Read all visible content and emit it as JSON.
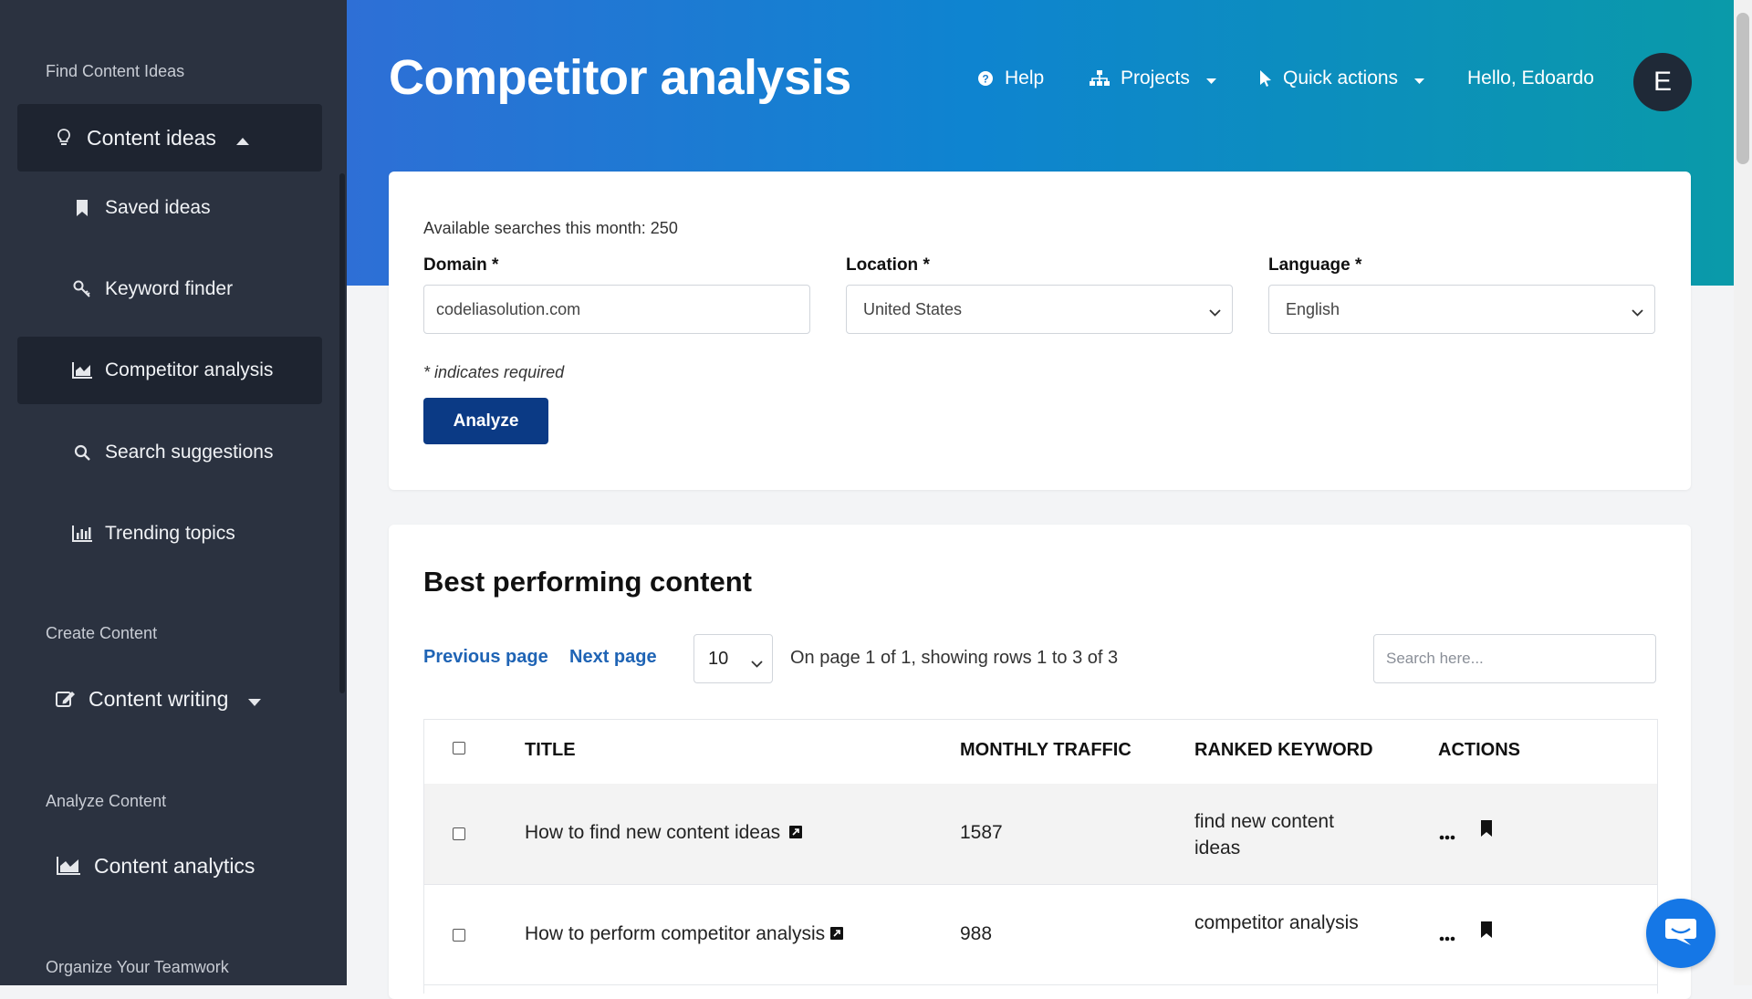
{
  "sidebar": {
    "sections": [
      "Find Content Ideas",
      "Create Content",
      "Analyze Content",
      "Organize Your Teamwork"
    ],
    "content_ideas": "Content ideas",
    "items": [
      {
        "label": "Saved ideas",
        "icon": "bookmark-icon"
      },
      {
        "label": "Keyword finder",
        "icon": "key-icon"
      },
      {
        "label": "Competitor analysis",
        "icon": "area-chart-icon"
      },
      {
        "label": "Search suggestions",
        "icon": "search-icon"
      },
      {
        "label": "Trending topics",
        "icon": "bar-chart-icon"
      }
    ],
    "content_writing": "Content writing",
    "content_analytics": "Content analytics"
  },
  "header": {
    "title": "Competitor analysis",
    "help": "Help",
    "projects": "Projects",
    "quick_actions": "Quick actions",
    "greeting": "Hello, Edoardo",
    "avatar_letter": "E"
  },
  "form": {
    "available": "Available searches this month: 250",
    "domain_label": "Domain *",
    "domain_value": "codeliasolution.com",
    "location_label": "Location *",
    "location_value": "United States",
    "language_label": "Language *",
    "language_value": "English",
    "required_note": "* indicates required",
    "analyze": "Analyze"
  },
  "results": {
    "title": "Best performing content",
    "prev": "Previous page",
    "next": "Next page",
    "page_size": "10",
    "page_info": "On page 1 of 1, showing rows 1 to 3 of 3",
    "search_placeholder": "Search here...",
    "columns": [
      "TITLE",
      "MONTHLY TRAFFIC",
      "RANKED KEYWORD",
      "ACTIONS"
    ],
    "rows": [
      {
        "title": "How to find new content ideas",
        "traffic": "1587",
        "keyword": "find new content ideas"
      },
      {
        "title": "How to perform competitor analysis",
        "traffic": "988",
        "keyword": "competitor analysis"
      }
    ]
  },
  "colors": {
    "sidebar": "#2b3240",
    "primary_button": "#0b3a85",
    "link": "#1f64b5",
    "chat": "#1577e6"
  }
}
